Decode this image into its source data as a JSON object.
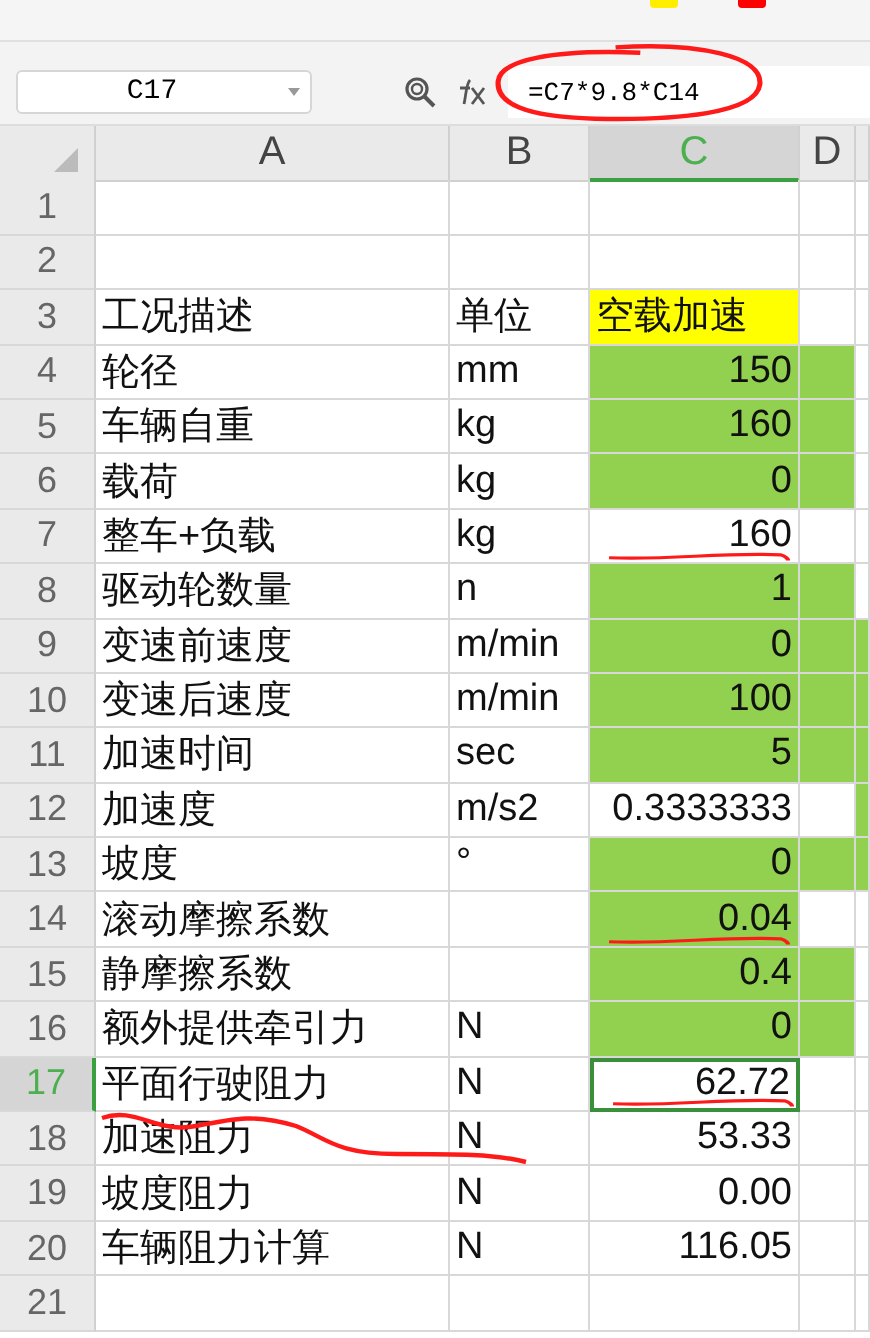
{
  "name_box": {
    "value": "C17"
  },
  "formula_bar": {
    "value": "=C7*9.8*C14",
    "circled": true
  },
  "columns": [
    {
      "label": "A",
      "selected": false
    },
    {
      "label": "B",
      "selected": false
    },
    {
      "label": "C",
      "selected": true
    },
    {
      "label": "D",
      "selected": false
    }
  ],
  "rows": [
    {
      "number": "1",
      "selected": false,
      "cells": [
        null,
        null,
        null,
        null,
        null
      ]
    },
    {
      "number": "2",
      "selected": false,
      "cells": [
        null,
        null,
        null,
        null,
        null
      ]
    },
    {
      "number": "3",
      "selected": false,
      "cells": [
        {
          "kind": "text",
          "text": "工况描述"
        },
        {
          "kind": "text",
          "text": "单位"
        },
        {
          "kind": "text",
          "text": "空载加速",
          "color": "#ffff00"
        },
        null,
        null
      ]
    },
    {
      "number": "4",
      "selected": false,
      "cells": [
        {
          "kind": "text",
          "text": "轮径"
        },
        {
          "kind": "text",
          "text": "mm"
        },
        {
          "kind": "number",
          "text": "150",
          "color": "#92d050"
        },
        {
          "color": "#92d050"
        },
        null
      ]
    },
    {
      "number": "5",
      "selected": false,
      "cells": [
        {
          "kind": "text",
          "text": "车辆自重"
        },
        {
          "kind": "text",
          "text": "kg"
        },
        {
          "kind": "number",
          "text": "160",
          "color": "#92d050"
        },
        {
          "color": "#92d050"
        },
        null
      ]
    },
    {
      "number": "6",
      "selected": false,
      "cells": [
        {
          "kind": "text",
          "text": "载荷"
        },
        {
          "kind": "text",
          "text": "kg"
        },
        {
          "kind": "number",
          "text": "0",
          "color": "#92d050"
        },
        {
          "color": "#92d050"
        },
        null
      ]
    },
    {
      "number": "7",
      "selected": false,
      "cells": [
        {
          "kind": "text",
          "text": "整车+负载"
        },
        {
          "kind": "text",
          "text": "kg"
        },
        {
          "kind": "number",
          "text": "160",
          "underlined": true
        },
        null,
        null
      ]
    },
    {
      "number": "8",
      "selected": false,
      "cells": [
        {
          "kind": "text",
          "text": "驱动轮数量"
        },
        {
          "kind": "text",
          "text": "n"
        },
        {
          "kind": "number",
          "text": "1",
          "color": "#92d050"
        },
        {
          "color": "#92d050"
        },
        null
      ]
    },
    {
      "number": "9",
      "selected": false,
      "cells": [
        {
          "kind": "text",
          "text": "变速前速度"
        },
        {
          "kind": "text",
          "text": "m/min"
        },
        {
          "kind": "number",
          "text": "0",
          "color": "#92d050"
        },
        {
          "color": "#92d050"
        },
        {
          "color": "#92d050"
        }
      ]
    },
    {
      "number": "10",
      "selected": false,
      "cells": [
        {
          "kind": "text",
          "text": "变速后速度"
        },
        {
          "kind": "text",
          "text": "m/min"
        },
        {
          "kind": "number",
          "text": "100",
          "color": "#92d050"
        },
        {
          "color": "#92d050"
        },
        {
          "color": "#92d050"
        }
      ]
    },
    {
      "number": "11",
      "selected": false,
      "cells": [
        {
          "kind": "text",
          "text": "加速时间"
        },
        {
          "kind": "text",
          "text": "sec"
        },
        {
          "kind": "number",
          "text": "5",
          "color": "#92d050"
        },
        {
          "color": "#92d050"
        },
        {
          "color": "#92d050"
        }
      ]
    },
    {
      "number": "12",
      "selected": false,
      "cells": [
        {
          "kind": "text",
          "text": "加速度"
        },
        {
          "kind": "text",
          "text": "m/s2"
        },
        {
          "kind": "number",
          "text": "0.3333333"
        },
        null,
        {
          "color": "#92d050"
        }
      ]
    },
    {
      "number": "13",
      "selected": false,
      "cells": [
        {
          "kind": "text",
          "text": "坡度"
        },
        {
          "kind": "text",
          "text": "°"
        },
        {
          "kind": "number",
          "text": "0",
          "color": "#92d050"
        },
        {
          "color": "#92d050"
        },
        {
          "color": "#92d050"
        }
      ]
    },
    {
      "number": "14",
      "selected": false,
      "cells": [
        {
          "kind": "text",
          "text": "滚动摩擦系数"
        },
        null,
        {
          "kind": "number",
          "text": "0.04",
          "color": "#92d050",
          "underlined": true
        },
        null,
        null
      ]
    },
    {
      "number": "15",
      "selected": false,
      "cells": [
        {
          "kind": "text",
          "text": "静摩擦系数"
        },
        null,
        {
          "kind": "number",
          "text": "0.4",
          "color": "#92d050"
        },
        {
          "color": "#92d050"
        },
        null
      ]
    },
    {
      "number": "16",
      "selected": false,
      "cells": [
        {
          "kind": "text",
          "text": "额外提供牵引力"
        },
        {
          "kind": "text",
          "text": "N"
        },
        {
          "kind": "number",
          "text": "0",
          "color": "#92d050"
        },
        {
          "color": "#92d050"
        },
        null
      ]
    },
    {
      "number": "17",
      "selected": true,
      "cells": [
        {
          "kind": "text",
          "text": "平面行驶阻力",
          "underlined": true
        },
        {
          "kind": "text",
          "text": "N"
        },
        {
          "kind": "number",
          "text": "62.72",
          "selected": true,
          "underlined": true
        },
        null,
        null
      ]
    },
    {
      "number": "18",
      "selected": false,
      "cells": [
        {
          "kind": "text",
          "text": "加速阻力"
        },
        {
          "kind": "text",
          "text": "N"
        },
        {
          "kind": "number",
          "text": "53.33"
        },
        null,
        null
      ]
    },
    {
      "number": "19",
      "selected": false,
      "cells": [
        {
          "kind": "text",
          "text": "坡度阻力"
        },
        {
          "kind": "text",
          "text": "N"
        },
        {
          "kind": "number",
          "text": "0.00"
        },
        null,
        null
      ]
    },
    {
      "number": "20",
      "selected": false,
      "cells": [
        {
          "kind": "text",
          "text": "车辆阻力计算"
        },
        {
          "kind": "text",
          "text": "N"
        },
        {
          "kind": "number",
          "text": "116.05"
        },
        null,
        null
      ]
    },
    {
      "number": "21",
      "selected": false,
      "cells": [
        null,
        null,
        null,
        null,
        null
      ]
    }
  ]
}
